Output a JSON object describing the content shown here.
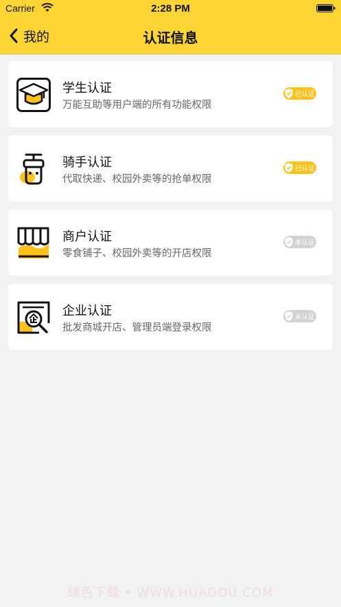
{
  "status_bar": {
    "carrier": "Carrier",
    "time": "2:28 PM"
  },
  "nav": {
    "back_label": "我的",
    "title": "认证信息"
  },
  "cards": [
    {
      "title": "学生认证",
      "desc": "万能互助等用户端的所有功能权限",
      "badge": "已认证",
      "verified": true,
      "icon": "graduation-cap-icon"
    },
    {
      "title": "骑手认证",
      "desc": "代取快递、校园外卖等的抢单权限",
      "badge": "已认证",
      "verified": true,
      "icon": "delivery-rider-icon"
    },
    {
      "title": "商户认证",
      "desc": "零食铺子、校园外卖等的开店权限",
      "badge": "未认证",
      "verified": false,
      "icon": "shop-awning-icon"
    },
    {
      "title": "企业认证",
      "desc": "批发商城开店、管理员端登录权限",
      "badge": "未认证",
      "verified": false,
      "icon": "enterprise-search-icon"
    }
  ],
  "colors": {
    "brand_yellow": "#fcd535",
    "verified_badge": "#fcc21b",
    "unverified_badge": "#d2d2d2"
  },
  "watermark": "绿色下载 • WWW.HUAGOU.COM"
}
